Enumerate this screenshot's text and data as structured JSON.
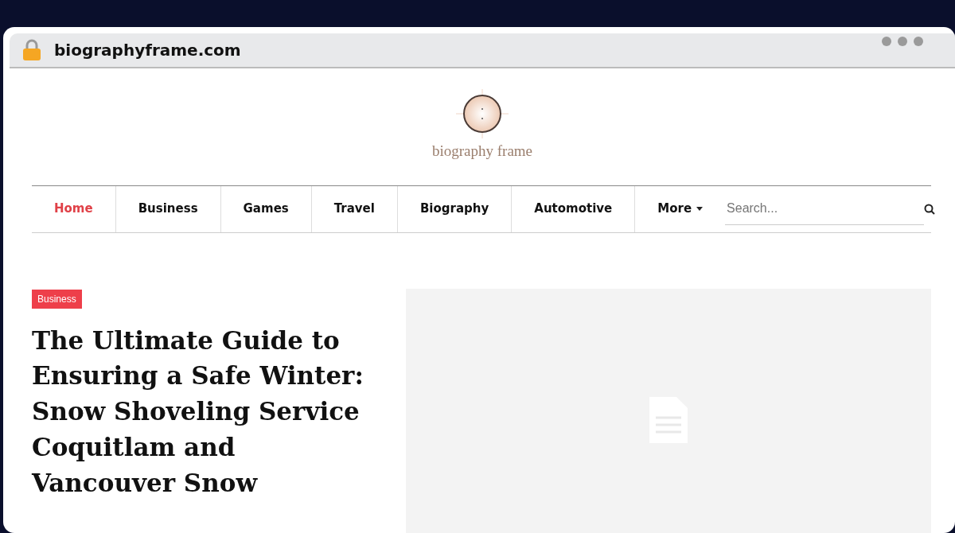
{
  "browser": {
    "url": "biographyframe.com"
  },
  "site": {
    "logo_text": "biography frame"
  },
  "nav": [
    {
      "label": "Home",
      "selected": true
    },
    {
      "label": "Business",
      "selected": false
    },
    {
      "label": "Games",
      "selected": false
    },
    {
      "label": "Travel",
      "selected": false
    },
    {
      "label": "Biography",
      "selected": false
    },
    {
      "label": "Automotive",
      "selected": false
    },
    {
      "label": "More",
      "selected": false,
      "kind": "dropdown"
    }
  ],
  "search": {
    "placeholder": "Search..."
  },
  "article": {
    "category": "Business",
    "title": "The Ultimate Guide to Ensuring a Safe Winter: Snow Shoveling Service Coquitlam and Vancouver Snow",
    "image": {
      "kind": "placeholder"
    }
  }
}
